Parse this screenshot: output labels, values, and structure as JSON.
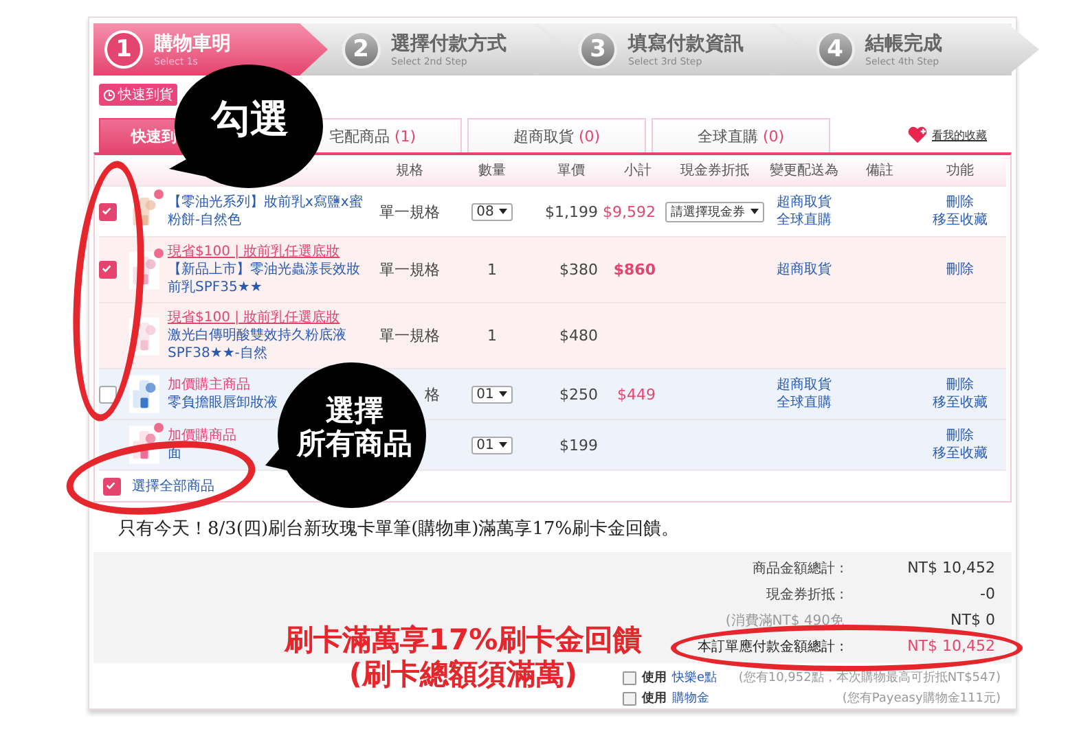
{
  "steps": [
    {
      "number": "1",
      "title": "購物車明",
      "subtitle": "Select 1s",
      "selected": true
    },
    {
      "number": "2",
      "title": "選擇付款方式",
      "subtitle": "Select 2nd Step",
      "selected": false
    },
    {
      "number": "3",
      "title": "填寫付款資訊",
      "subtitle": "Select 3rd Step",
      "selected": false
    },
    {
      "number": "4",
      "title": "結帳完成",
      "subtitle": "Select 4th Step",
      "selected": false
    }
  ],
  "delivery_tag": {
    "label": "快速到貨"
  },
  "tabs": [
    {
      "label": "快速到",
      "selected": true
    },
    {
      "label": "宅配商品",
      "count": "(1)",
      "selected": false
    },
    {
      "label": "超商取貨",
      "count": "(0)",
      "selected": false
    },
    {
      "label": "全球直購",
      "count": "(0)",
      "selected": false
    }
  ],
  "favorites_link": "看我的收藏",
  "table": {
    "columns": [
      "規格",
      "數量",
      "單價",
      "小計",
      "現金券折抵",
      "變更配送為",
      "備註",
      "功能"
    ],
    "rows": [
      {
        "kind": "main",
        "checked": true,
        "badge": true,
        "name": "【零油光系列】妝前乳x寫鹽x蜜粉餅-自然色",
        "spec": "單一規格",
        "quantity": {
          "kind": "select",
          "value": "08"
        },
        "price": "$1,199",
        "subtotal": "$9,592",
        "coupon": "請選擇現金券",
        "delivery": [
          "超商取貨",
          "全球直購"
        ],
        "actions": [
          "刪除",
          "移至收藏"
        ]
      },
      {
        "kind": "bundle",
        "checked": true,
        "badge": true,
        "offer": "現省$100 | 妝前乳任選底妝",
        "name": "【新品上市】零油光蟲漾長效妝前乳SPF35★★",
        "spec": "單一規格",
        "quantity": {
          "kind": "text",
          "value": "1"
        },
        "price": "$380",
        "subtotal": "$860",
        "delivery": [
          "超商取貨"
        ],
        "actions": [
          "刪除"
        ]
      },
      {
        "kind": "bundle",
        "badge": false,
        "offer": "現省$100 | 妝前乳任選底妝",
        "name": "激光白傳明酸雙效持久粉底液SPF38★★-自然",
        "spec": "單一規格",
        "quantity": {
          "kind": "text",
          "value": "1"
        },
        "price": "$480"
      },
      {
        "kind": "addon",
        "checked": false,
        "badge": false,
        "offer": "加價購主商品",
        "name": "零負擔眼唇卸妝液",
        "spec": "格",
        "quantity": {
          "kind": "select",
          "value": "01"
        },
        "price": "$250",
        "subtotal": "$449",
        "delivery": [
          "超商取貨",
          "全球直購"
        ],
        "actions": [
          "刪除",
          "移至收藏"
        ]
      },
      {
        "kind": "addon",
        "badge": true,
        "offer": "加價購商品",
        "name": "面",
        "quantity": {
          "kind": "select",
          "value": "01"
        },
        "price": "$199",
        "actions": [
          "刪除",
          "移至收藏"
        ]
      }
    ]
  },
  "select_all": {
    "label": "選擇全部商品",
    "checked": true
  },
  "promo": "只有今天！8/3(四)刷台新玫瑰卡單筆(購物車)滿萬享17%刷卡金回饋。",
  "summary": [
    {
      "kind": "normal",
      "label": "商品金額總計 :",
      "value": "NT$ 10,452"
    },
    {
      "kind": "normal",
      "label": "現金券折抵 :",
      "value": "-0"
    },
    {
      "kind": "note",
      "label": "(消費滿NT$ 490免",
      "value": "NT$ 0"
    },
    {
      "kind": "total",
      "label": "本訂單應付款金額總計 :",
      "value": "NT$ 10,452"
    }
  ],
  "options": [
    {
      "checked": false,
      "label": "使用",
      "link": "快樂e點",
      "note": "(您有10,952點，本次購物最高可折抵NT$547)"
    },
    {
      "checked": false,
      "label": "使用",
      "link": "購物金",
      "note": "(您有Payeasy購物金111元)"
    }
  ],
  "annotations": {
    "bubbles": [
      {
        "lines": [
          "勾選"
        ]
      },
      {
        "lines": [
          "選擇",
          "所有商品"
        ]
      }
    ],
    "callout": [
      "刷卡滿萬享17%刷卡金回饋",
      "(刷卡總額須滿萬)"
    ]
  }
}
